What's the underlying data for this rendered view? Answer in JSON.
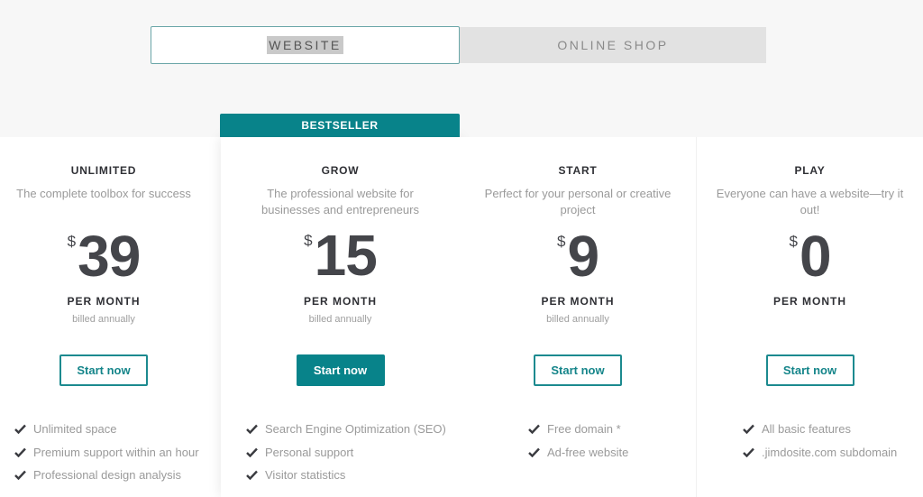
{
  "toggle": {
    "tabs": [
      {
        "label": "WEBSITE",
        "active": true
      },
      {
        "label": "ONLINE SHOP",
        "active": false
      }
    ]
  },
  "colors": {
    "accent": "#08838a",
    "text_dark": "#2f3035",
    "text_muted": "#9a9a9a",
    "background_top": "#f7f7f7"
  },
  "plans": [
    {
      "name": "UNLIMITED",
      "description": "The complete toolbox for success",
      "currency": "$",
      "price": "39",
      "period": "PER MONTH",
      "billing": "billed annually",
      "cta": "Start now",
      "features": [
        "Unlimited space",
        "Premium support within an hour",
        "Professional design analysis"
      ]
    },
    {
      "badge": "BESTSELLER",
      "name": "GROW",
      "description": "The professional website for businesses and entrepreneurs",
      "currency": "$",
      "price": "15",
      "period": "PER MONTH",
      "billing": "billed annually",
      "cta": "Start now",
      "features": [
        "Search Engine Optimization (SEO)",
        "Personal support",
        "Visitor statistics"
      ]
    },
    {
      "name": "START",
      "description": "Perfect for your personal or creative project",
      "currency": "$",
      "price": "9",
      "period": "PER MONTH",
      "billing": "billed annually",
      "cta": "Start now",
      "features": [
        "Free domain *",
        "Ad-free website"
      ]
    },
    {
      "name": "PLAY",
      "description": "Everyone can have a website—try it out!",
      "currency": "$",
      "price": "0",
      "period": "PER MONTH",
      "cta": "Start now",
      "features": [
        "All basic features",
        ".jimdosite.com subdomain"
      ]
    }
  ],
  "icons": {
    "feature_check": "check-icon"
  }
}
